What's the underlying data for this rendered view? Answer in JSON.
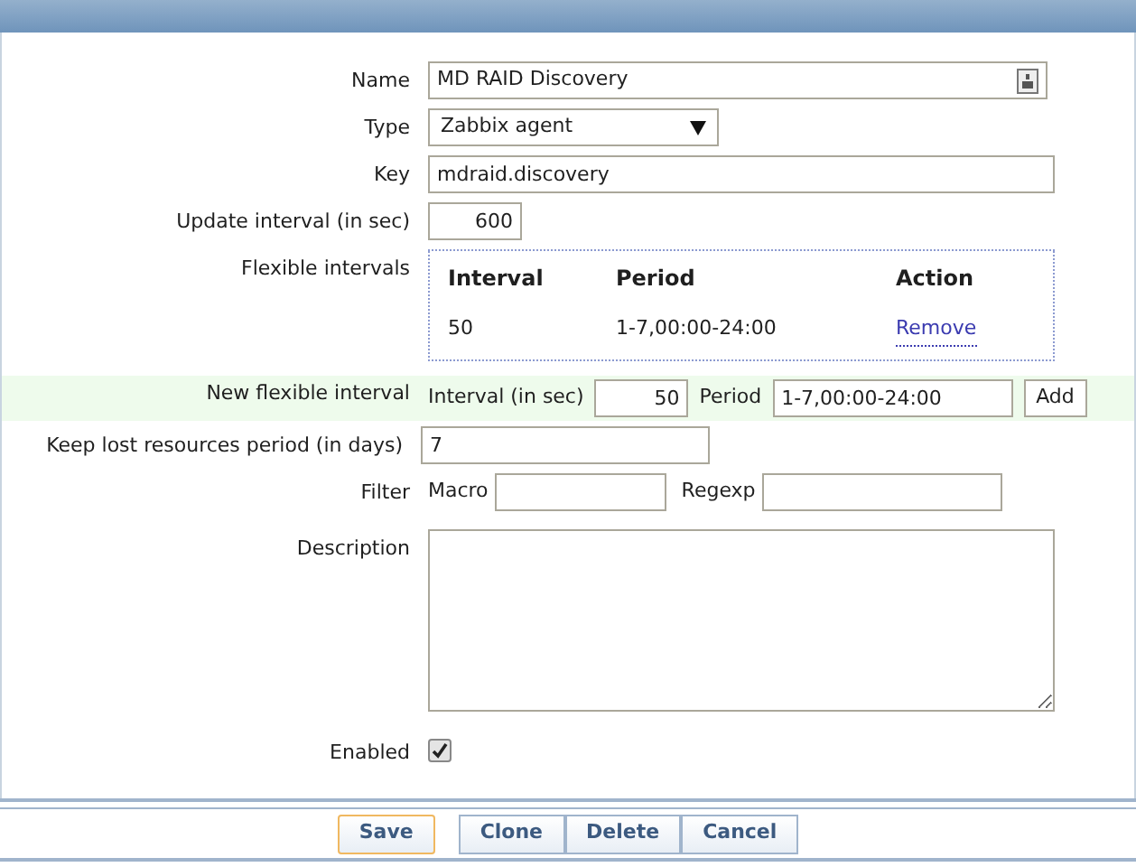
{
  "name": {
    "label": "Name",
    "value": "MD RAID Discovery"
  },
  "type": {
    "label": "Type",
    "value": "Zabbix agent"
  },
  "key": {
    "label": "Key",
    "value": "mdraid.discovery"
  },
  "update_interval": {
    "label": "Update interval (in sec)",
    "value": "600"
  },
  "flexible_intervals": {
    "label": "Flexible intervals",
    "columns": [
      "Interval",
      "Period",
      "Action"
    ],
    "rows": [
      {
        "interval": "50",
        "period": "1-7,00:00-24:00",
        "action": "Remove"
      }
    ]
  },
  "new_flexible_interval": {
    "label": "New flexible interval",
    "interval_label": "Interval (in sec)",
    "interval_value": "50",
    "period_label": "Period",
    "period_value": "1-7,00:00-24:00",
    "button": "Add"
  },
  "keep_lost": {
    "label": "Keep lost resources period (in days)",
    "value": "7"
  },
  "filter": {
    "label": "Filter",
    "macro_label": "Macro",
    "regexp_label": "Regexp"
  },
  "description": {
    "label": "Description"
  },
  "enabled": {
    "label": "Enabled",
    "checked": true
  },
  "buttons": [
    {
      "label": "Save",
      "kind": "primary"
    },
    {
      "label": "Clone",
      "kind": "group"
    },
    {
      "label": "Delete",
      "kind": "group"
    },
    {
      "label": "Cancel",
      "kind": "group"
    }
  ]
}
